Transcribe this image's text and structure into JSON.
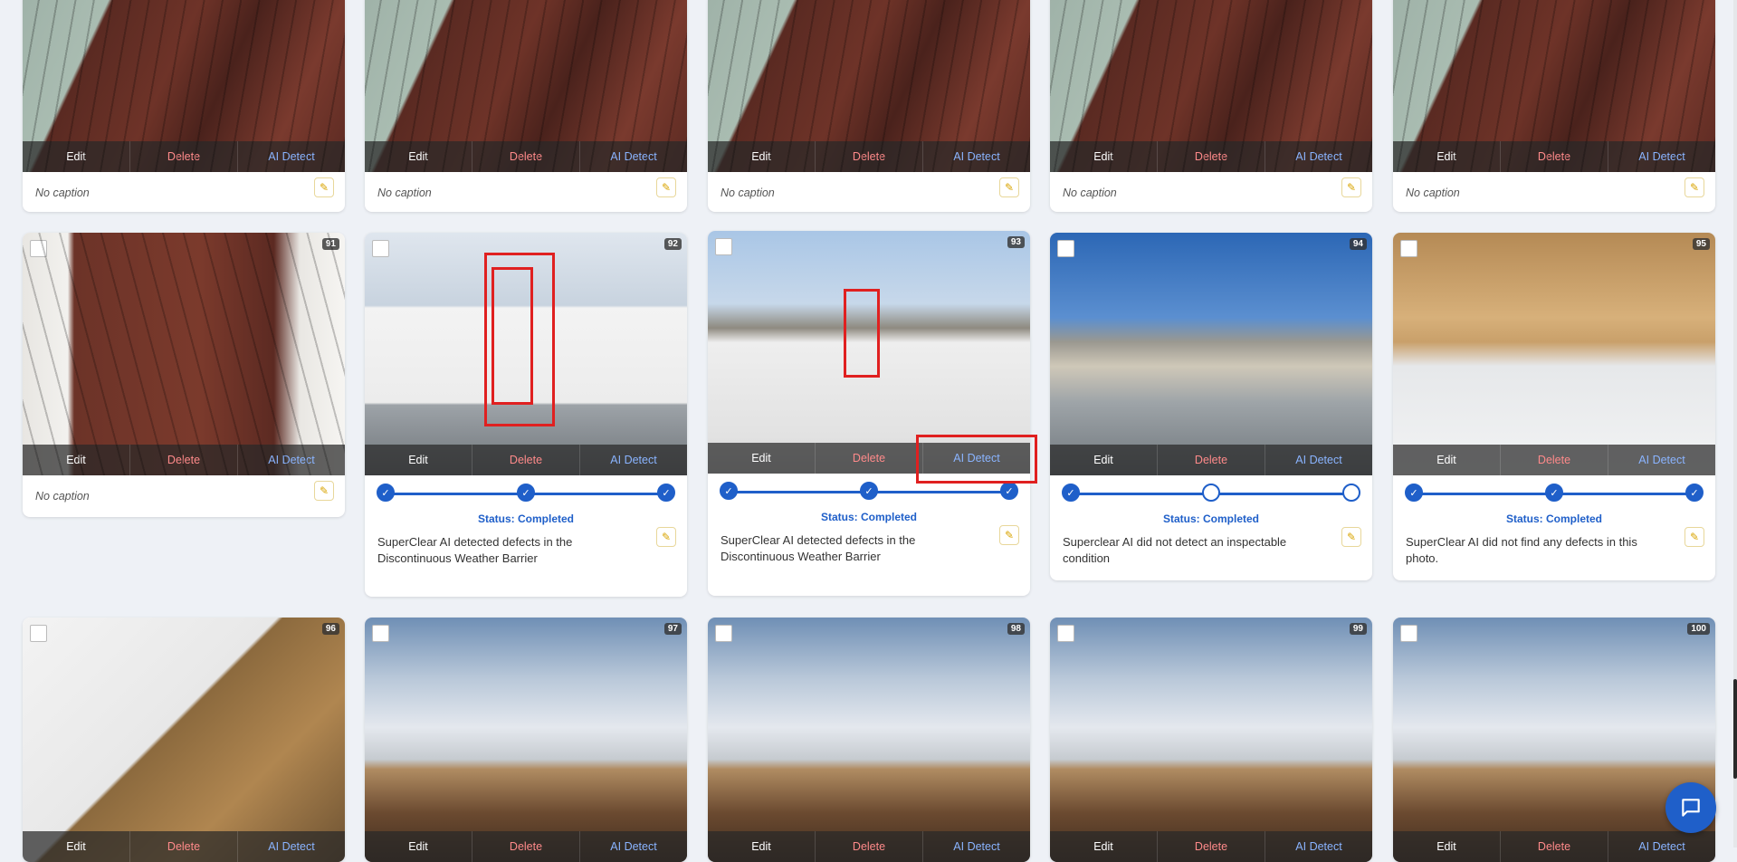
{
  "labels": {
    "edit": "Edit",
    "delete": "Delete",
    "ai_detect": "AI Detect",
    "no_caption": "No caption",
    "status": "Status: Completed"
  },
  "rows": [
    {
      "cards": [
        {
          "number": "",
          "caption": "No caption"
        },
        {
          "number": "",
          "caption": "No caption"
        },
        {
          "number": "",
          "caption": "No caption"
        },
        {
          "number": "",
          "caption": "No caption"
        },
        {
          "number": "",
          "caption": "No caption"
        }
      ]
    },
    {
      "cards": [
        {
          "number": "91",
          "caption": "No caption"
        },
        {
          "number": "92",
          "steps": [
            true,
            true,
            true
          ],
          "status": "Status: Completed",
          "description": "SuperClear AI detected defects in the Discontinuous Weather Barrier"
        },
        {
          "number": "93",
          "steps": [
            true,
            true,
            true
          ],
          "status": "Status: Completed",
          "description": "SuperClear AI detected defects in the Discontinuous Weather Barrier"
        },
        {
          "number": "94",
          "steps": [
            true,
            false,
            false
          ],
          "status": "Status: Completed",
          "description": "Superclear AI did not detect an inspectable condition"
        },
        {
          "number": "95",
          "steps": [
            true,
            true,
            true
          ],
          "status": "Status: Completed",
          "description": "SuperClear AI did not find any defects in this photo."
        }
      ]
    },
    {
      "cards": [
        {
          "number": "96"
        },
        {
          "number": "97"
        },
        {
          "number": "98"
        },
        {
          "number": "99"
        },
        {
          "number": "100"
        }
      ]
    }
  ],
  "icons": {
    "pencil": "pencil-icon",
    "chat": "chat-icon",
    "check": "check-icon"
  },
  "colors": {
    "accent": "#1f5fc9",
    "delete": "#ff8a8a",
    "ai_detect": "#8ab4ff",
    "highlight": "#e02020"
  }
}
